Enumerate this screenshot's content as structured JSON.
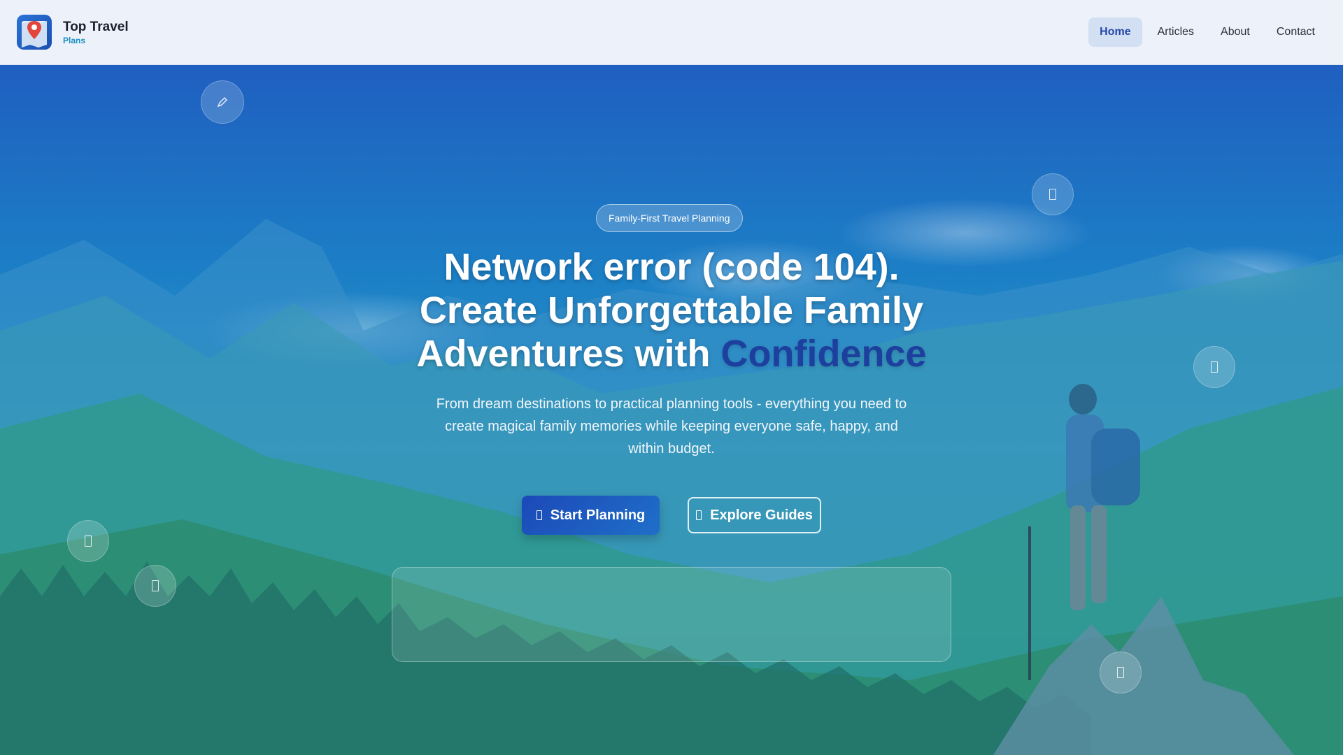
{
  "brand": {
    "title": "Top Travel",
    "subtitle": "Plans"
  },
  "nav": {
    "items": [
      {
        "label": "Home",
        "active": true
      },
      {
        "label": "Articles",
        "active": false
      },
      {
        "label": "About",
        "active": false
      },
      {
        "label": "Contact",
        "active": false
      }
    ]
  },
  "hero": {
    "badge": "Family-First Travel Planning",
    "headline_line1": "Network error (code 104).",
    "headline_line2": "Create Unforgettable Family",
    "headline_line3_prefix": "Adventures with ",
    "headline_accent": "Confidence",
    "subtext": "From dream destinations to practical planning tools - everything you need to create magical family memories while keeping everyone safe, happy, and within budget.",
    "primary_button": "Start Planning",
    "secondary_button": "Explore Guides"
  },
  "floating_icons": [
    "pencil-icon",
    "map-icon",
    "compass-icon",
    "camera-icon",
    "plane-icon",
    "heart-icon"
  ],
  "colors": {
    "accent": "#1d3f9e",
    "nav_active_bg": "#d3e0f3",
    "nav_active_text": "#2347a8",
    "brand_sub": "#1a8fc0"
  }
}
